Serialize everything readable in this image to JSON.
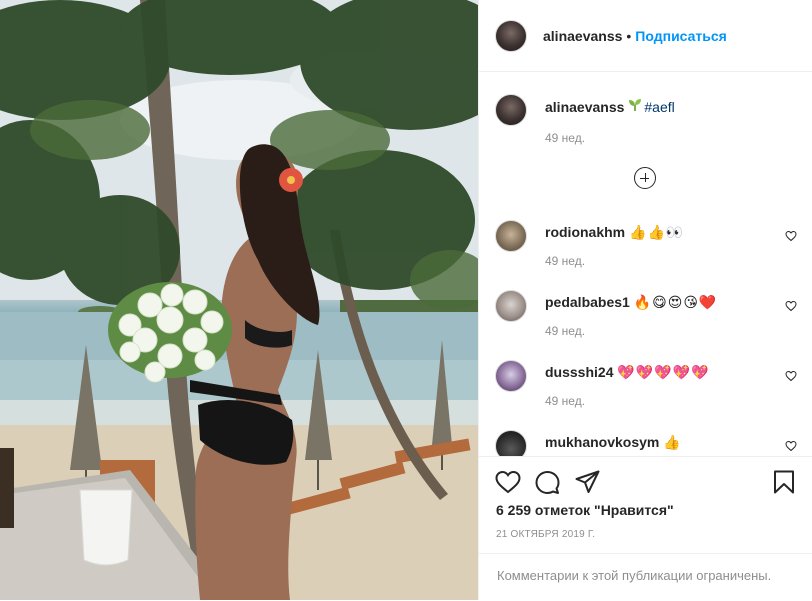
{
  "header": {
    "username": "alinaevanss",
    "separator": "•",
    "follow_label": "Подписаться"
  },
  "caption": {
    "username": "alinaevanss",
    "hashtag": "#aefl",
    "time": "49 нед."
  },
  "comments": [
    {
      "username": "rodionakhm",
      "text": "👍👍👀",
      "time": "49 нед."
    },
    {
      "username": "pedalbabes1",
      "text": "🔥😋😍😘❤️",
      "time": "49 нед."
    },
    {
      "username": "dussshi24",
      "text": "💖💖💖💖💖",
      "time": "49 нед."
    },
    {
      "username": "mukhanovkosym",
      "text": "👍",
      "time": ""
    }
  ],
  "actions": {
    "likes": "6 259 отметок \"Нравится\"",
    "date": "21 октября 2019 г.",
    "restricted": "Комментарии к этой публикации ограничены."
  },
  "icons": {
    "like": "heart-outline-icon",
    "comment": "speech-bubble-icon",
    "share": "paper-plane-icon",
    "save": "bookmark-icon",
    "load_more": "plus-circle-icon"
  },
  "colors": {
    "accent": "#0095f6",
    "text": "#262626",
    "muted": "#8e8e8e",
    "divider": "#efefef",
    "hashtag": "#00376b"
  }
}
